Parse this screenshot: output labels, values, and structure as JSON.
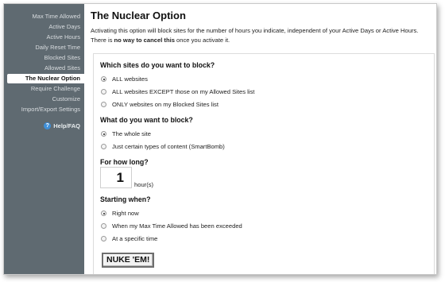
{
  "sidebar": {
    "items": [
      {
        "label": "Max Time Allowed"
      },
      {
        "label": "Active Days"
      },
      {
        "label": "Active Hours"
      },
      {
        "label": "Daily Reset Time"
      },
      {
        "label": "Blocked Sites"
      },
      {
        "label": "Allowed Sites"
      },
      {
        "label": "The Nuclear Option"
      },
      {
        "label": "Require Challenge"
      },
      {
        "label": "Customize"
      },
      {
        "label": "Import/Export Settings"
      }
    ],
    "active_index": 6,
    "help_label": "Help/FAQ",
    "help_icon": "question-icon"
  },
  "main": {
    "title": "The Nuclear Option",
    "intro_line1": "Activating this option will block sites for the number of hours you indicate, independent of your Active Days or Active Hours.",
    "intro_line2_pre": "There is ",
    "intro_line2_bold": "no way to cancel this",
    "intro_line2_post": " once you activate it.",
    "q1": {
      "heading": "Which sites do you want to block?",
      "options": [
        {
          "label": "ALL websites",
          "checked": true
        },
        {
          "label": "ALL websites EXCEPT those on my Allowed Sites list",
          "checked": false
        },
        {
          "label": "ONLY websites on my Blocked Sites list",
          "checked": false
        }
      ]
    },
    "q2": {
      "heading": "What do you want to block?",
      "options": [
        {
          "label": "The whole site",
          "checked": true
        },
        {
          "label": "Just certain types of content (SmartBomb)",
          "checked": false
        }
      ]
    },
    "q3": {
      "heading": "For how long?",
      "value": "1",
      "unit": "hour(s)"
    },
    "q4": {
      "heading": "Starting when?",
      "options": [
        {
          "label": "Right now",
          "checked": true
        },
        {
          "label": "When my Max Time Allowed has been exceeded",
          "checked": false
        },
        {
          "label": "At a specific time",
          "checked": false
        }
      ]
    },
    "nuke_label": "NUKE 'EM!"
  }
}
